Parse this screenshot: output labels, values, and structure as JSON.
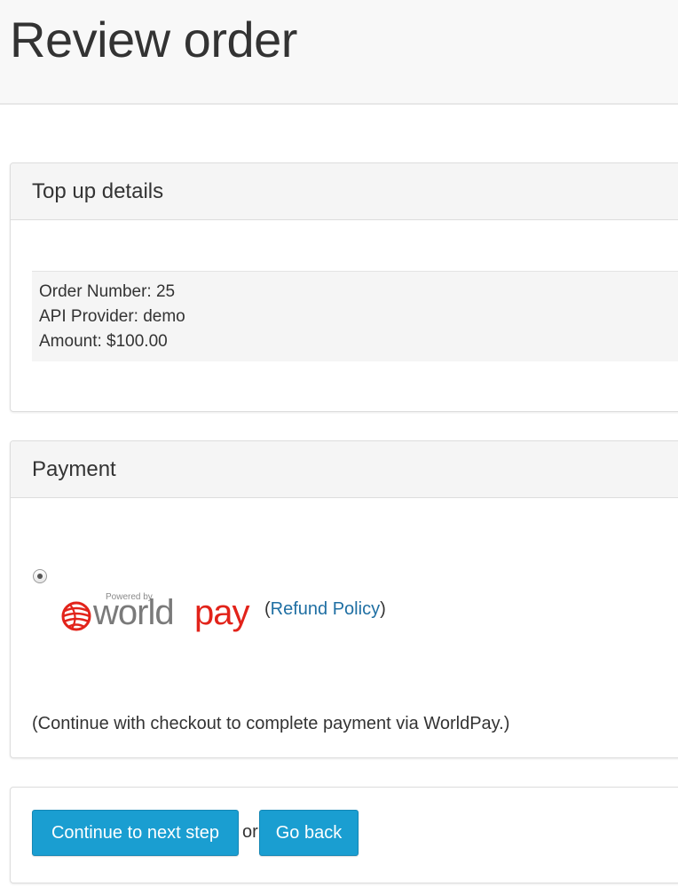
{
  "page": {
    "title": "Review order"
  },
  "topup": {
    "heading": "Top up details",
    "order_number": "Order Number: 25",
    "api_provider": "API Provider: demo",
    "amount": "Amount: $100.00"
  },
  "payment": {
    "heading": "Payment",
    "method_selected": true,
    "logo": {
      "powered_by": "Powered by",
      "brand_world": "world",
      "brand_pay": "pay",
      "icon": "worldpay-globe-icon"
    },
    "refund_open": "(",
    "refund_link": "Refund Policy",
    "refund_close": ")",
    "note": "(Continue with checkout to complete payment via WorldPay.)"
  },
  "actions": {
    "continue_label": "Continue to next step",
    "or_label": "or",
    "back_label": "Go back"
  },
  "colors": {
    "button_bg": "#1a9ed1",
    "link": "#1f6fa3",
    "worldpay_red": "#e2231a",
    "worldpay_gray": "#7a7a7a"
  }
}
